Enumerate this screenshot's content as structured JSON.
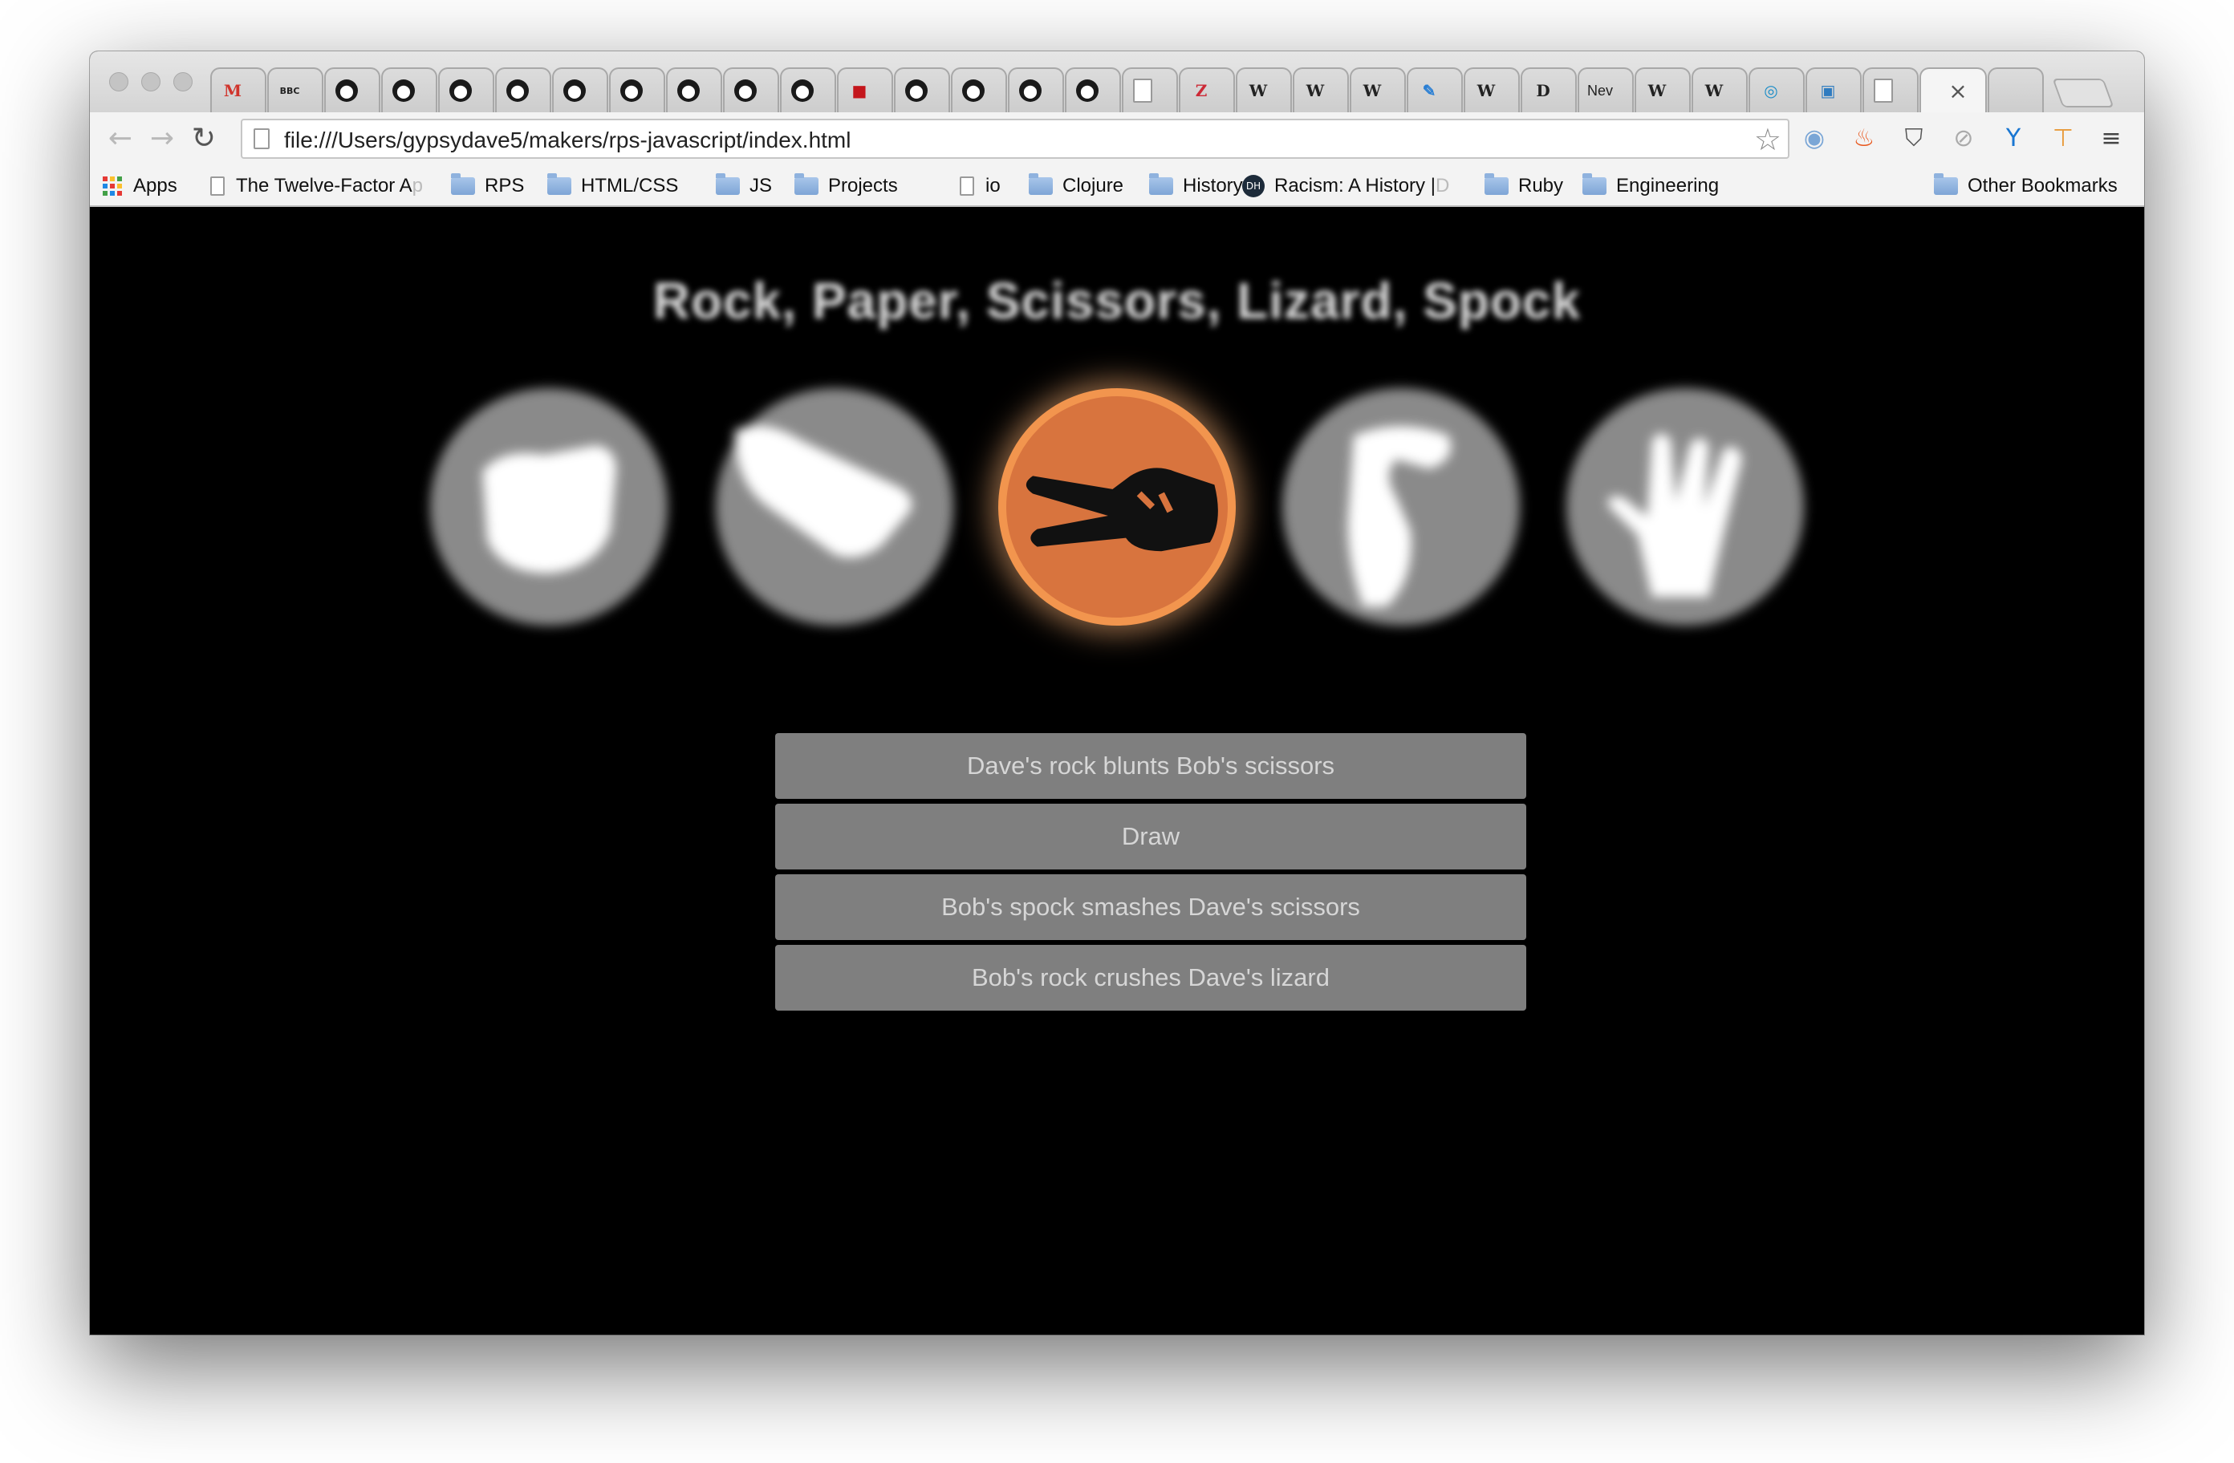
{
  "browser": {
    "tabs": [
      {
        "icon": "gmail-icon",
        "glyph": "M"
      },
      {
        "icon": "bbc-icon",
        "glyph": "BBC"
      },
      {
        "icon": "github-icon",
        "glyph": "⬤"
      },
      {
        "icon": "github-icon",
        "glyph": "⬤"
      },
      {
        "icon": "github-icon",
        "glyph": "⬤"
      },
      {
        "icon": "github-icon",
        "glyph": "⬤"
      },
      {
        "icon": "github-icon",
        "glyph": "⬤"
      },
      {
        "icon": "github-icon",
        "glyph": "⬤"
      },
      {
        "icon": "github-icon",
        "glyph": "⬤"
      },
      {
        "icon": "github-icon",
        "glyph": "⬤"
      },
      {
        "icon": "github-icon",
        "glyph": "⬤"
      },
      {
        "icon": "news-icon",
        "glyph": "■"
      },
      {
        "icon": "github-icon",
        "glyph": "⬤"
      },
      {
        "icon": "github-icon",
        "glyph": "⬤"
      },
      {
        "icon": "github-icon",
        "glyph": "⬤"
      },
      {
        "icon": "github-icon",
        "glyph": "⬤"
      },
      {
        "icon": "page-icon",
        "glyph": ""
      },
      {
        "icon": "zotero-icon",
        "glyph": "Z"
      },
      {
        "icon": "wikipedia-icon",
        "glyph": "W"
      },
      {
        "icon": "wikipedia-icon",
        "glyph": "W"
      },
      {
        "icon": "wikipedia-icon",
        "glyph": "W"
      },
      {
        "icon": "app-icon",
        "glyph": "✎"
      },
      {
        "icon": "wikipedia-icon",
        "glyph": "W"
      },
      {
        "icon": "dictionary-icon",
        "glyph": "D"
      },
      {
        "icon": "news-icon",
        "glyph": "Nev"
      },
      {
        "icon": "wikipedia-icon",
        "glyph": "W"
      },
      {
        "icon": "wikipedia-icon",
        "glyph": "W"
      },
      {
        "icon": "circle-icon",
        "glyph": "◎"
      },
      {
        "icon": "trello-icon",
        "glyph": "▣"
      },
      {
        "icon": "page-icon",
        "glyph": ""
      },
      {
        "icon": "close-icon",
        "glyph": "×",
        "active": true
      },
      {
        "icon": "apple-icon",
        "glyph": ""
      }
    ],
    "url": "file:///Users/gypsydave5/makers/rps-javascript/index.html",
    "bookmarks": [
      {
        "label": "Apps",
        "type": "apps"
      },
      {
        "label": "The Twelve-Factor A",
        "faded": "p",
        "type": "page"
      },
      {
        "label": "RPS",
        "type": "folder"
      },
      {
        "label": "HTML/CSS",
        "type": "folder"
      },
      {
        "label": "JS",
        "type": "folder"
      },
      {
        "label": "Projects",
        "type": "folder"
      },
      {
        "label": "io",
        "type": "page"
      },
      {
        "label": "Clojure",
        "type": "folder"
      },
      {
        "label": "History",
        "type": "folder"
      },
      {
        "label": "Racism: A History | ",
        "faded": "D",
        "type": "dh"
      },
      {
        "label": "Ruby",
        "type": "folder"
      },
      {
        "label": "Engineering",
        "type": "folder"
      },
      {
        "label": "Other Bookmarks",
        "type": "folder"
      }
    ]
  },
  "game": {
    "title": "Rock, Paper, Scissors, Lizard, Spock",
    "choices": [
      {
        "name": "rock",
        "selected": false
      },
      {
        "name": "paper",
        "selected": false
      },
      {
        "name": "scissors",
        "selected": true
      },
      {
        "name": "lizard",
        "selected": false
      },
      {
        "name": "spock",
        "selected": false
      }
    ],
    "results": [
      "Dave's rock blunts Bob's scissors",
      "Draw",
      "Bob's spock smashes Dave's scissors",
      "Bob's rock crushes Dave's lizard"
    ]
  },
  "colors": {
    "selected_fill": "#d8743e",
    "selected_ring": "#f2954e",
    "result_bg": "#7f7f7f",
    "page_bg": "#000000"
  }
}
